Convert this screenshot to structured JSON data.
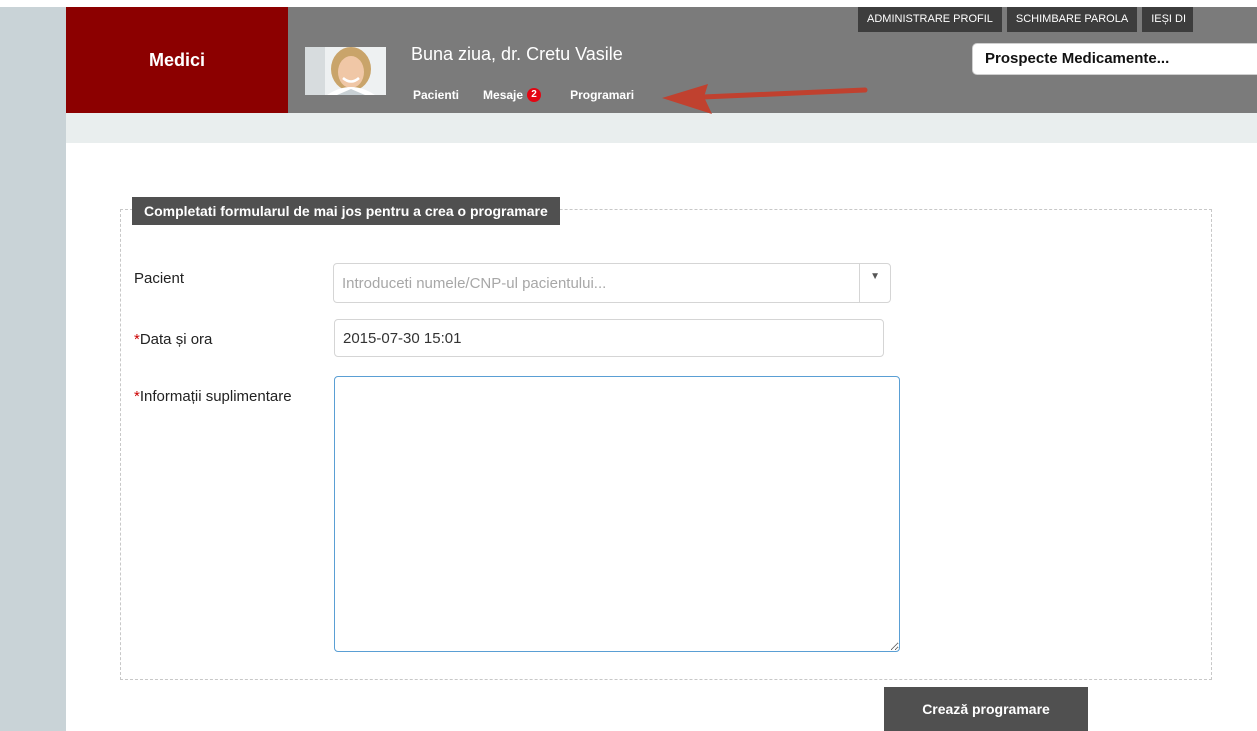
{
  "brand": {
    "title": "Medici"
  },
  "user": {
    "greeting": "Buna ziua, dr. Cretu Vasile"
  },
  "nav": {
    "patients": "Pacienti",
    "messages": "Mesaje",
    "messages_count": "2",
    "appointments": "Programari"
  },
  "top_actions": {
    "profile": "ADMINISTRARE PROFIL",
    "password": "SCHIMBARE PAROLA",
    "logout": "IEȘI DI"
  },
  "drug_search": {
    "value": "Prospecte Medicamente..."
  },
  "form": {
    "legend": "Completati formularul de mai jos pentru a crea o programare",
    "patient": {
      "label": "Pacient",
      "placeholder": "Introduceti numele/CNP-ul pacientului..."
    },
    "datetime": {
      "required_mark": "*",
      "label": "Data și ora",
      "value": "2015-07-30 15:01"
    },
    "info": {
      "required_mark": "*",
      "label": "Informații suplimentare",
      "value": ""
    },
    "submit": "Crează programare"
  },
  "colors": {
    "brand_red": "#8c0000",
    "header_gray": "#7b7b7b",
    "dark_button": "#505050",
    "arrow": "#c0412f",
    "badge_red": "#e30613"
  }
}
